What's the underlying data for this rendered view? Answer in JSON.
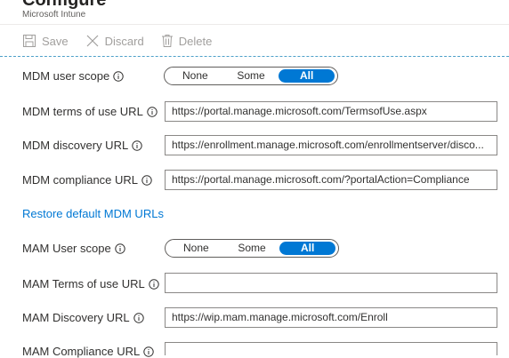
{
  "header": {
    "title": "Configure",
    "subtitle": "Microsoft Intune"
  },
  "toolbar": {
    "save_label": "Save",
    "discard_label": "Discard",
    "delete_label": "Delete"
  },
  "mdm": {
    "user_scope": {
      "label": "MDM user scope",
      "options": [
        "None",
        "Some",
        "All"
      ],
      "selected": "All"
    },
    "terms_url": {
      "label": "MDM terms of use URL",
      "value": "https://portal.manage.microsoft.com/TermsofUse.aspx"
    },
    "discovery_url": {
      "label": "MDM discovery URL",
      "value": "https://enrollment.manage.microsoft.com/enrollmentserver/disco..."
    },
    "compliance_url": {
      "label": "MDM compliance URL",
      "value": "https://portal.manage.microsoft.com/?portalAction=Compliance"
    }
  },
  "restore_link": "Restore default MDM URLs",
  "mam": {
    "user_scope": {
      "label": "MAM User scope",
      "options": [
        "None",
        "Some",
        "All"
      ],
      "selected": "All"
    },
    "terms_url": {
      "label": "MAM Terms of use URL",
      "value": ""
    },
    "discovery_url": {
      "label": "MAM Discovery URL",
      "value": "https://wip.mam.manage.microsoft.com/Enroll"
    },
    "compliance_url": {
      "label": "MAM Compliance URL",
      "value": ""
    }
  },
  "icons": {
    "save": "save-icon",
    "discard": "close-icon",
    "delete": "trash-icon",
    "info": "info-icon"
  },
  "colors": {
    "accent": "#0078d4",
    "link": "#0078d4",
    "separator": "#4ea0c9",
    "disabled_text": "#a19f9d"
  }
}
